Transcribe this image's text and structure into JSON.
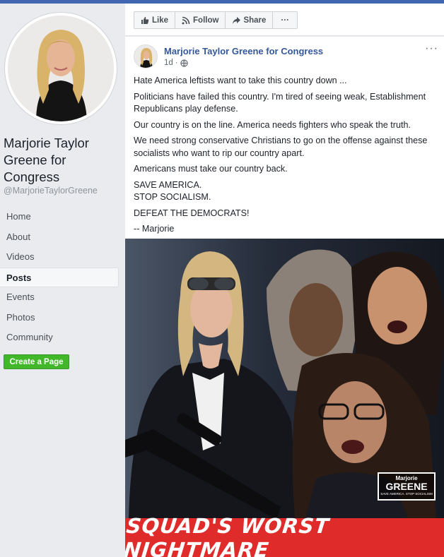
{
  "page": {
    "name": "Marjorie Taylor Greene for Congress",
    "handle": "@MarjorieTaylorGreene"
  },
  "sidebar": {
    "items": [
      {
        "label": "Home"
      },
      {
        "label": "About"
      },
      {
        "label": "Videos"
      },
      {
        "label": "Posts",
        "active": true
      },
      {
        "label": "Events"
      },
      {
        "label": "Photos"
      },
      {
        "label": "Community"
      }
    ],
    "create_page": "Create a Page"
  },
  "actions": {
    "like": "Like",
    "follow": "Follow",
    "share": "Share",
    "more": "···"
  },
  "post": {
    "author": "Marjorie Taylor Greene for Congress",
    "time": "1d",
    "privacy_icon": "globe-icon",
    "more": "···",
    "paragraphs": [
      "Hate America leftists want to take this country down ...",
      "Politicians have failed this country. I'm tired of seeing weak, Establishment Republicans play defense.",
      "Our country is on the line. America needs fighters who speak the truth.",
      "We need strong conservative Christians to go on the offense against these socialists who want to rip our country apart.",
      "Americans must take our country back.",
      "SAVE AMERICA.",
      "STOP SOCIALISM.",
      "DEFEAT THE DEMOCRATS!",
      "-- Marjorie"
    ],
    "image": {
      "banner": "SQUAD'S WORST NIGHTMARE",
      "logo_top": "Marjorie",
      "logo_main": "GREENE",
      "logo_sub": "SAVE AMERICA. STOP SOCIALISM"
    }
  },
  "colors": {
    "brand_blue": "#4267b2",
    "link_blue": "#365899",
    "create_green": "#42b72a",
    "banner_red": "#e02b2b"
  }
}
